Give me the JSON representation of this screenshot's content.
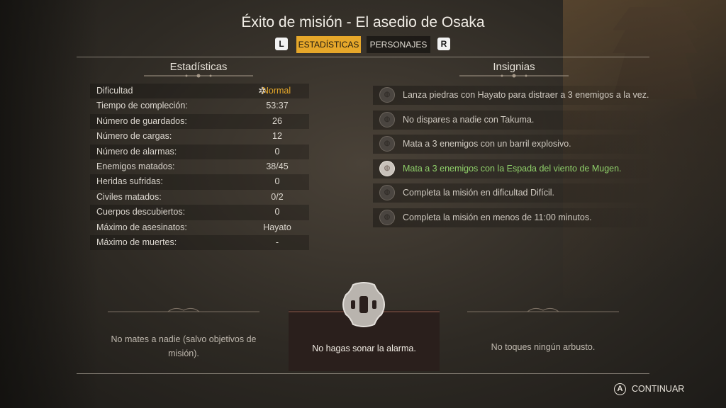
{
  "header": {
    "title": "Éxito de misión - El asedio de Osaka",
    "left_key": "L",
    "right_key": "R",
    "tabs": [
      {
        "label": "ESTADÍSTICAS",
        "active": true
      },
      {
        "label": "PERSONAJES",
        "active": false
      }
    ]
  },
  "stats": {
    "title": "Estadísticas",
    "rows": [
      {
        "label": "Dificultad",
        "value": "Normal"
      },
      {
        "label": "Tiempo de compleción:",
        "value": "53:37"
      },
      {
        "label": "Número de guardados:",
        "value": "26"
      },
      {
        "label": "Número de cargas:",
        "value": "12"
      },
      {
        "label": "Número de alarmas:",
        "value": "0"
      },
      {
        "label": "Enemigos matados:",
        "value": "38/45"
      },
      {
        "label": "Heridas sufridas:",
        "value": "0"
      },
      {
        "label": "Civiles matados:",
        "value": "0/2"
      },
      {
        "label": "Cuerpos descubiertos:",
        "value": "0"
      },
      {
        "label": "Máximo de asesinatos:",
        "value": "Hayato"
      },
      {
        "label": "Máximo de muertes:",
        "value": "-"
      }
    ]
  },
  "badges": {
    "title": "Insignias",
    "items": [
      {
        "text": "Lanza piedras con Hayato para distraer a 3 enemigos a la vez.",
        "earned": false
      },
      {
        "text": "No dispares a nadie con Takuma.",
        "earned": false
      },
      {
        "text": "Mata a 3 enemigos con un barril explosivo.",
        "earned": false
      },
      {
        "text": "Mata a 3 enemigos con la Espada del viento de Mugen.",
        "earned": true
      },
      {
        "text": "Completa la misión en dificultad Difícil.",
        "earned": false
      },
      {
        "text": "Completa la misión en menos de 11:00 minutos.",
        "earned": false
      }
    ]
  },
  "challenges": {
    "left": "No mates a nadie (salvo objetivos de misión).",
    "center": "No hagas sonar la alarma.",
    "right": "No toques ningún arbusto."
  },
  "footer": {
    "button": "A",
    "continue_label": "CONTINUAR"
  },
  "colors": {
    "accent": "#e6a72a",
    "earned": "#8fd06a"
  }
}
